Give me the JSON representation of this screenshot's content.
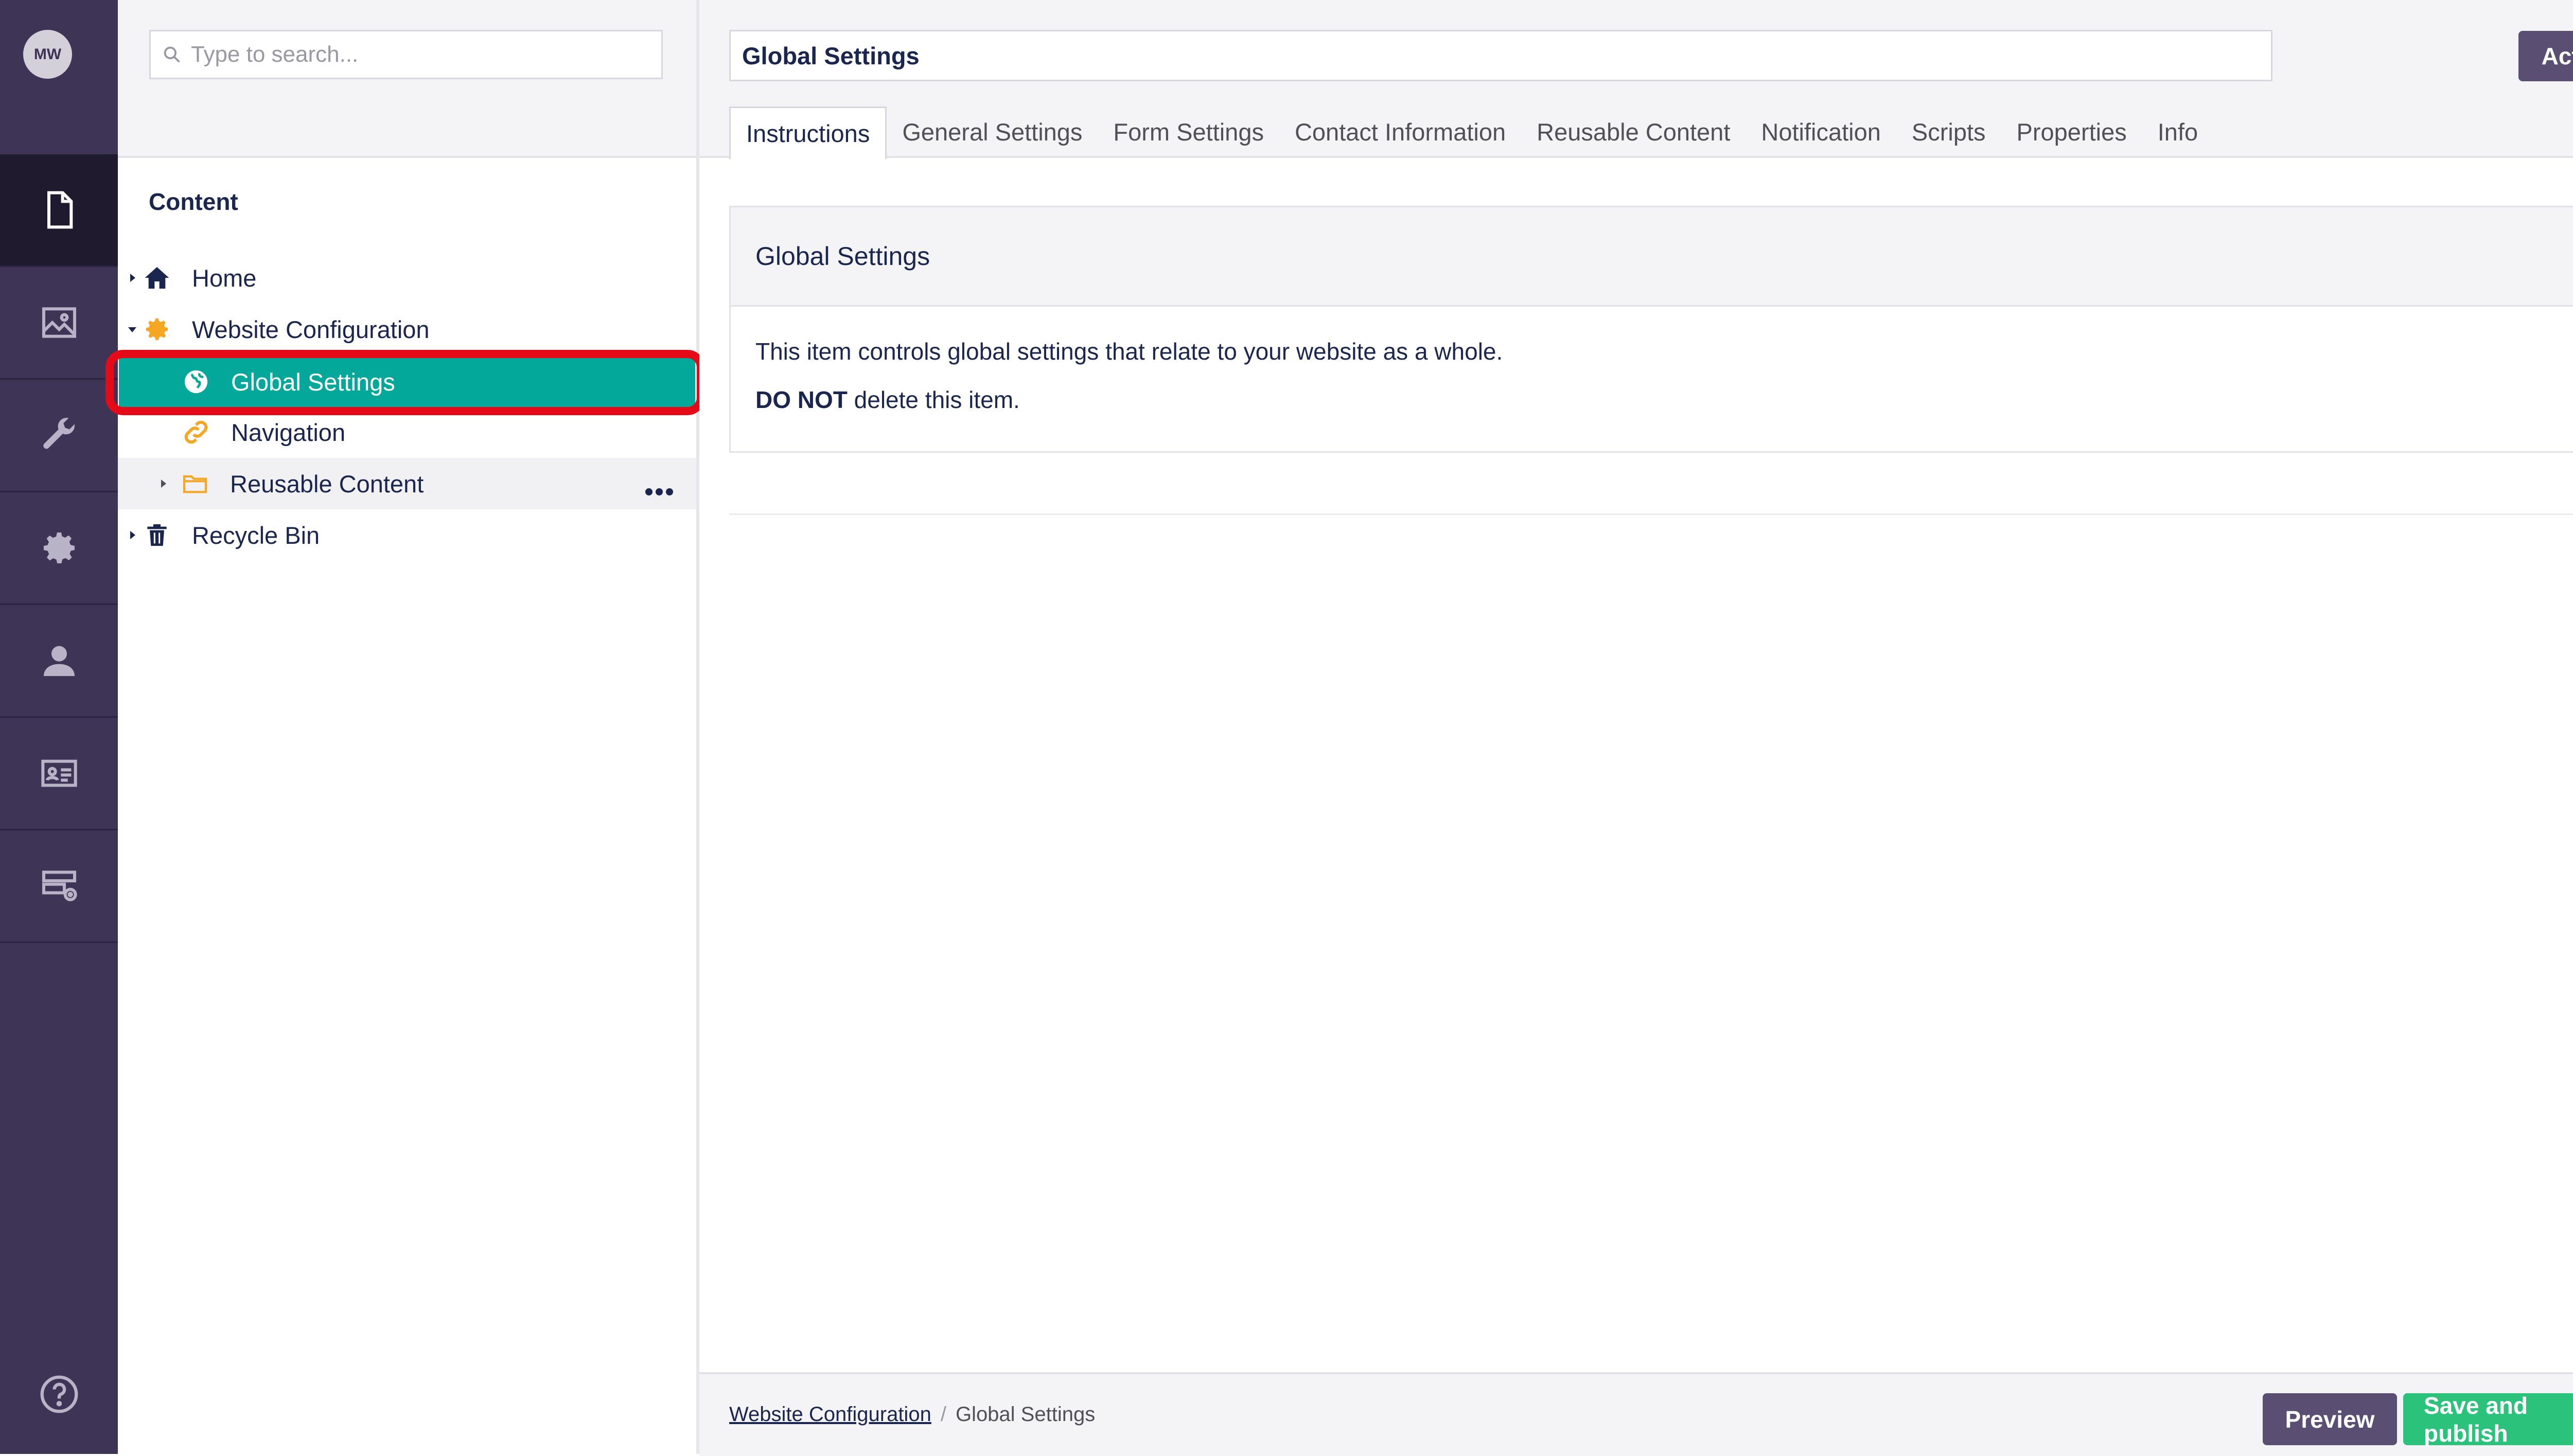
{
  "user": {
    "initials": "MW"
  },
  "rail": {
    "items": [
      {
        "icon": "document-icon",
        "active": true
      },
      {
        "icon": "image-icon"
      },
      {
        "icon": "wrench-icon"
      },
      {
        "icon": "gear-icon"
      },
      {
        "icon": "user-icon"
      },
      {
        "icon": "id-card-icon"
      },
      {
        "icon": "forms-icon"
      }
    ],
    "help_icon": "help-icon"
  },
  "search": {
    "placeholder": "Type to search..."
  },
  "tree": {
    "title": "Content",
    "nodes": [
      {
        "label": "Home",
        "icon": "home-icon"
      },
      {
        "label": "Website Configuration",
        "icon": "cog-orange-icon"
      },
      {
        "label": "Global Settings",
        "icon": "globe-icon"
      },
      {
        "label": "Navigation",
        "icon": "link-icon"
      },
      {
        "label": "Reusable Content",
        "icon": "folder-icon"
      },
      {
        "label": "Recycle Bin",
        "icon": "trash-icon"
      }
    ]
  },
  "editor": {
    "name": "Global Settings",
    "actions_label": "Actions",
    "tabs": [
      "Instructions",
      "General Settings",
      "Form Settings",
      "Contact Information",
      "Reusable Content",
      "Notification",
      "Scripts",
      "Properties",
      "Info"
    ],
    "active_tab": "Instructions",
    "card": {
      "title": "Global Settings",
      "line1": "This item controls global settings that relate to your website as a whole.",
      "line2_bold": "DO NOT",
      "line2_rest": " delete this item."
    }
  },
  "footer": {
    "breadcrumb": [
      "Website Configuration",
      "Global Settings"
    ],
    "preview_label": "Preview",
    "publish_label": "Save and publish"
  },
  "colors": {
    "rail": "#3e3455",
    "selected": "#03a89a",
    "publish": "#2bc37c",
    "purple_button": "#5a4f73",
    "highlight": "#e50a17",
    "accent_orange": "#f5a623"
  }
}
